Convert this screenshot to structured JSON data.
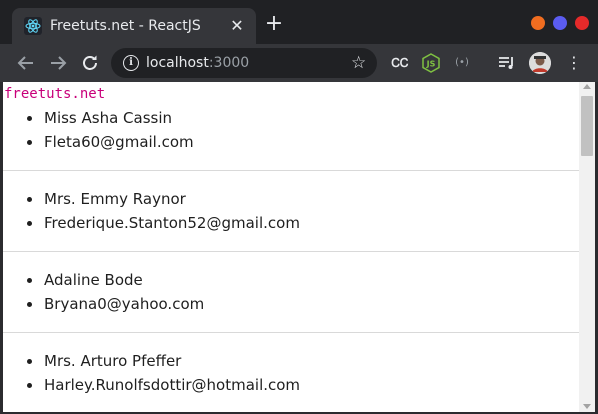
{
  "browser": {
    "tab": {
      "title": "Freetuts.net - ReactJS",
      "favicon": "react-icon"
    },
    "new_tab_symbol": "+",
    "window_controls": {
      "minimize_color": "#f06d20",
      "maximize_color": "#5b5cf0",
      "close_color": "#e52a2a"
    },
    "address": {
      "host": "localhost",
      "port": ":3000"
    }
  },
  "page": {
    "brand": "freetuts.net",
    "contacts": [
      {
        "name": "Miss Asha Cassin",
        "email": "Fleta60@gmail.com"
      },
      {
        "name": "Mrs. Emmy Raynor",
        "email": "Frederique.Stanton52@gmail.com"
      },
      {
        "name": "Adaline Bode",
        "email": "Bryana0@yahoo.com"
      },
      {
        "name": "Mrs. Arturo Pfeffer",
        "email": "Harley.Runolfsdottir@hotmail.com"
      }
    ]
  },
  "colors": {
    "brand_text": "#c8007a",
    "tab_bg": "#35363a",
    "frame_bg": "#202124"
  }
}
